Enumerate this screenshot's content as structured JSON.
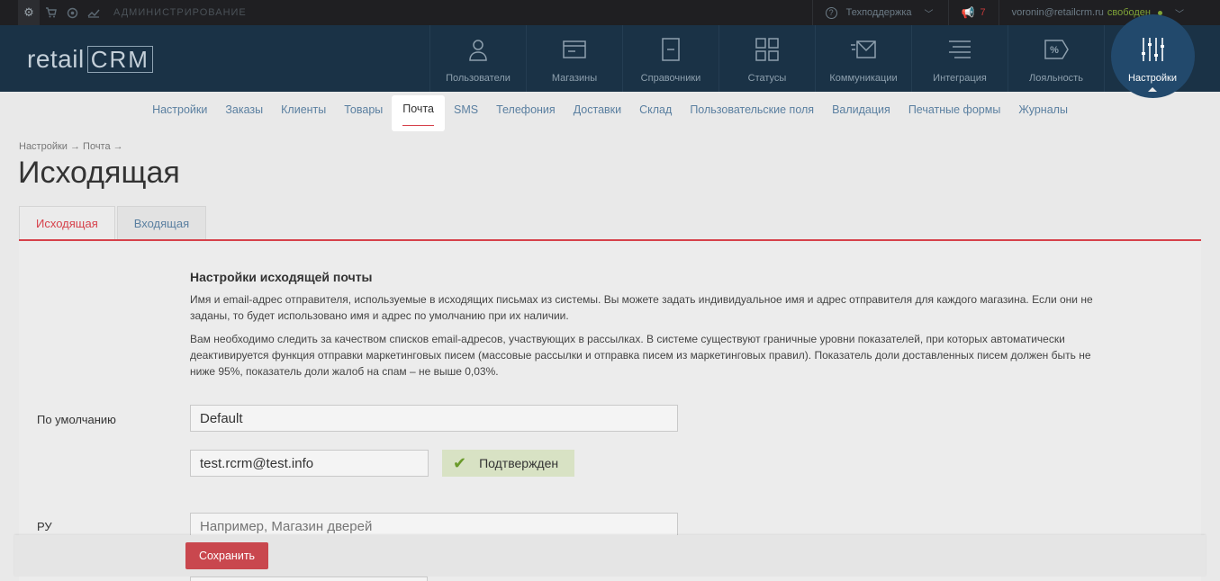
{
  "topbar": {
    "admin_label": "АДМИНИСТРИРОВАНИЕ",
    "support_label": "Техподдержка",
    "notifications_count": "7",
    "user_email": "voronin@retailcrm.ru",
    "user_status": "свободен"
  },
  "logo": {
    "part1": "retail",
    "part2": "CRM"
  },
  "nav": {
    "items": [
      {
        "label": "Пользователи",
        "icon": "user-icon"
      },
      {
        "label": "Магазины",
        "icon": "shop-icon"
      },
      {
        "label": "Справочники",
        "icon": "book-icon"
      },
      {
        "label": "Статусы",
        "icon": "status-icon"
      },
      {
        "label": "Коммуникации",
        "icon": "mail-icon"
      },
      {
        "label": "Интеграция",
        "icon": "integration-icon"
      },
      {
        "label": "Лояльность",
        "icon": "loyalty-icon"
      },
      {
        "label": "Настройки",
        "icon": "settings-sliders-icon"
      }
    ]
  },
  "submenu": {
    "items": [
      "Настройки",
      "Заказы",
      "Клиенты",
      "Товары",
      "Почта",
      "SMS",
      "Телефония",
      "Доставки",
      "Склад",
      "Пользовательские поля",
      "Валидация",
      "Печатные формы",
      "Журналы"
    ]
  },
  "breadcrumb": "Настройки → Почта →",
  "page_title": "Исходящая",
  "tabs": [
    "Исходящая",
    "Входящая"
  ],
  "section": {
    "title": "Настройки исходящей почты",
    "desc1": "Имя и email-адрес отправителя, используемые в исходящих письмах из системы. Вы можете задать индивидуальное имя и адрес отправителя для каждого магазина. Если они не заданы, то будет использовано имя и адрес по умолчанию при их наличии.",
    "desc2": "Вам необходимо следить за качеством списков email-адресов, участвующих в рассылках. В системе существуют граничные уровни показателей, при которых автоматически деактивируется функция отправки маркетинговых писем (массовые рассылки и отправка писем из маркетинговых правил). Показатель доли доставленных писем должен быть не ниже 95%, показатель доли жалоб на спам – не выше 0,03%."
  },
  "form": {
    "default_label": "По умолчанию",
    "default_name": "Default",
    "default_email": "test.rcrm@test.info",
    "confirmed_label": "Подтвержден",
    "ru_label": "РУ",
    "ru_placeholder": "Например, Магазин дверей"
  },
  "save_label": "Сохранить",
  "colors": {
    "accent": "#d6404a",
    "header": "#1a3246",
    "link": "#5a7fa0"
  }
}
